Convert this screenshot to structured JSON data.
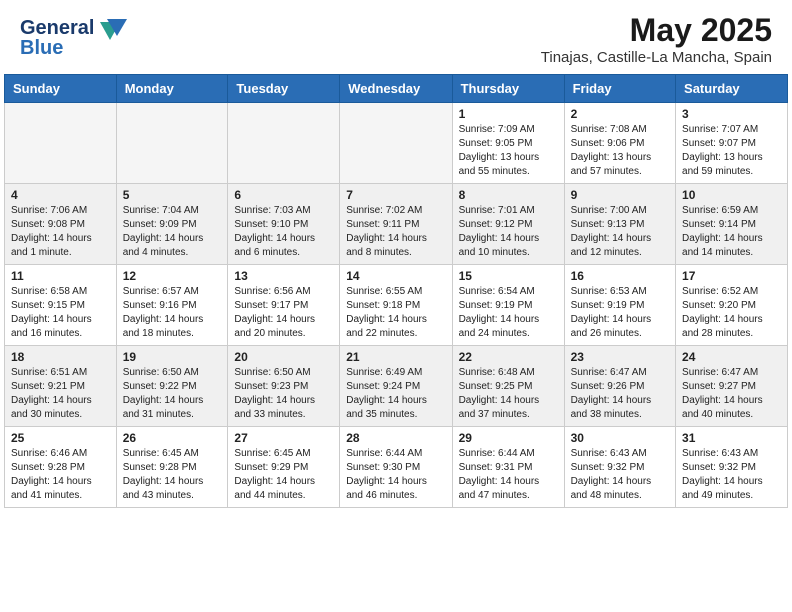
{
  "header": {
    "logo_line1": "General",
    "logo_line2": "Blue",
    "title": "May 2025",
    "subtitle": "Tinajas, Castille-La Mancha, Spain"
  },
  "weekdays": [
    "Sunday",
    "Monday",
    "Tuesday",
    "Wednesday",
    "Thursday",
    "Friday",
    "Saturday"
  ],
  "weeks": [
    [
      {
        "day": "",
        "info": ""
      },
      {
        "day": "",
        "info": ""
      },
      {
        "day": "",
        "info": ""
      },
      {
        "day": "",
        "info": ""
      },
      {
        "day": "1",
        "info": "Sunrise: 7:09 AM\nSunset: 9:05 PM\nDaylight: 13 hours\nand 55 minutes."
      },
      {
        "day": "2",
        "info": "Sunrise: 7:08 AM\nSunset: 9:06 PM\nDaylight: 13 hours\nand 57 minutes."
      },
      {
        "day": "3",
        "info": "Sunrise: 7:07 AM\nSunset: 9:07 PM\nDaylight: 13 hours\nand 59 minutes."
      }
    ],
    [
      {
        "day": "4",
        "info": "Sunrise: 7:06 AM\nSunset: 9:08 PM\nDaylight: 14 hours\nand 1 minute."
      },
      {
        "day": "5",
        "info": "Sunrise: 7:04 AM\nSunset: 9:09 PM\nDaylight: 14 hours\nand 4 minutes."
      },
      {
        "day": "6",
        "info": "Sunrise: 7:03 AM\nSunset: 9:10 PM\nDaylight: 14 hours\nand 6 minutes."
      },
      {
        "day": "7",
        "info": "Sunrise: 7:02 AM\nSunset: 9:11 PM\nDaylight: 14 hours\nand 8 minutes."
      },
      {
        "day": "8",
        "info": "Sunrise: 7:01 AM\nSunset: 9:12 PM\nDaylight: 14 hours\nand 10 minutes."
      },
      {
        "day": "9",
        "info": "Sunrise: 7:00 AM\nSunset: 9:13 PM\nDaylight: 14 hours\nand 12 minutes."
      },
      {
        "day": "10",
        "info": "Sunrise: 6:59 AM\nSunset: 9:14 PM\nDaylight: 14 hours\nand 14 minutes."
      }
    ],
    [
      {
        "day": "11",
        "info": "Sunrise: 6:58 AM\nSunset: 9:15 PM\nDaylight: 14 hours\nand 16 minutes."
      },
      {
        "day": "12",
        "info": "Sunrise: 6:57 AM\nSunset: 9:16 PM\nDaylight: 14 hours\nand 18 minutes."
      },
      {
        "day": "13",
        "info": "Sunrise: 6:56 AM\nSunset: 9:17 PM\nDaylight: 14 hours\nand 20 minutes."
      },
      {
        "day": "14",
        "info": "Sunrise: 6:55 AM\nSunset: 9:18 PM\nDaylight: 14 hours\nand 22 minutes."
      },
      {
        "day": "15",
        "info": "Sunrise: 6:54 AM\nSunset: 9:19 PM\nDaylight: 14 hours\nand 24 minutes."
      },
      {
        "day": "16",
        "info": "Sunrise: 6:53 AM\nSunset: 9:19 PM\nDaylight: 14 hours\nand 26 minutes."
      },
      {
        "day": "17",
        "info": "Sunrise: 6:52 AM\nSunset: 9:20 PM\nDaylight: 14 hours\nand 28 minutes."
      }
    ],
    [
      {
        "day": "18",
        "info": "Sunrise: 6:51 AM\nSunset: 9:21 PM\nDaylight: 14 hours\nand 30 minutes."
      },
      {
        "day": "19",
        "info": "Sunrise: 6:50 AM\nSunset: 9:22 PM\nDaylight: 14 hours\nand 31 minutes."
      },
      {
        "day": "20",
        "info": "Sunrise: 6:50 AM\nSunset: 9:23 PM\nDaylight: 14 hours\nand 33 minutes."
      },
      {
        "day": "21",
        "info": "Sunrise: 6:49 AM\nSunset: 9:24 PM\nDaylight: 14 hours\nand 35 minutes."
      },
      {
        "day": "22",
        "info": "Sunrise: 6:48 AM\nSunset: 9:25 PM\nDaylight: 14 hours\nand 37 minutes."
      },
      {
        "day": "23",
        "info": "Sunrise: 6:47 AM\nSunset: 9:26 PM\nDaylight: 14 hours\nand 38 minutes."
      },
      {
        "day": "24",
        "info": "Sunrise: 6:47 AM\nSunset: 9:27 PM\nDaylight: 14 hours\nand 40 minutes."
      }
    ],
    [
      {
        "day": "25",
        "info": "Sunrise: 6:46 AM\nSunset: 9:28 PM\nDaylight: 14 hours\nand 41 minutes."
      },
      {
        "day": "26",
        "info": "Sunrise: 6:45 AM\nSunset: 9:28 PM\nDaylight: 14 hours\nand 43 minutes."
      },
      {
        "day": "27",
        "info": "Sunrise: 6:45 AM\nSunset: 9:29 PM\nDaylight: 14 hours\nand 44 minutes."
      },
      {
        "day": "28",
        "info": "Sunrise: 6:44 AM\nSunset: 9:30 PM\nDaylight: 14 hours\nand 46 minutes."
      },
      {
        "day": "29",
        "info": "Sunrise: 6:44 AM\nSunset: 9:31 PM\nDaylight: 14 hours\nand 47 minutes."
      },
      {
        "day": "30",
        "info": "Sunrise: 6:43 AM\nSunset: 9:32 PM\nDaylight: 14 hours\nand 48 minutes."
      },
      {
        "day": "31",
        "info": "Sunrise: 6:43 AM\nSunset: 9:32 PM\nDaylight: 14 hours\nand 49 minutes."
      }
    ]
  ]
}
